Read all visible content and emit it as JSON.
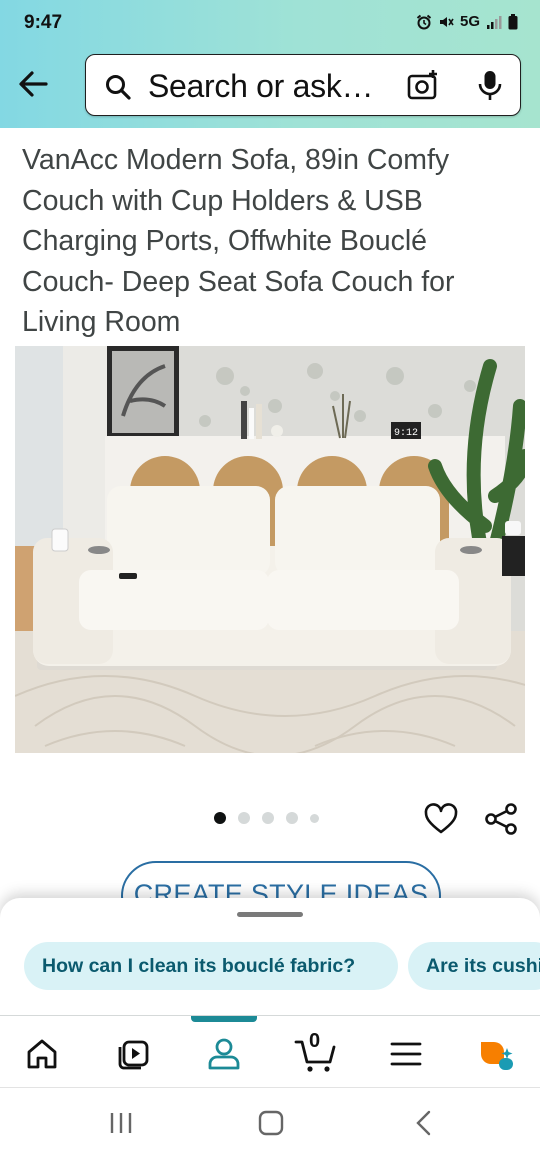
{
  "status_bar": {
    "time": "9:47",
    "network": "5G"
  },
  "search": {
    "placeholder": "Search or ask…"
  },
  "product": {
    "title": "VanAcc Modern Sofa, 89in Comfy Couch with Cup Holders & USB Charging Ports, Offwhite Bouclé Couch- Deep Seat Sofa Couch for Living Room",
    "image_count": 5,
    "active_image_index": 0,
    "clock_text": "9:12"
  },
  "style_button": {
    "label": "CREATE STYLE IDEAS"
  },
  "suggestions": [
    {
      "label": "How can I clean its bouclé fabric?"
    },
    {
      "label": "Are its cushions removable?"
    }
  ],
  "bottom_nav": {
    "cart_count": "0",
    "items": [
      "home-icon",
      "video-icon",
      "account-icon",
      "cart-icon",
      "menu-icon",
      "rufus-icon"
    ],
    "active": "account-icon"
  },
  "colors": {
    "header_start": "#83d8e3",
    "header_end": "#a6e4cf",
    "accent": "#1c8a96",
    "link_blue": "#2a6ea3",
    "chip_bg": "#d9f2f6"
  }
}
